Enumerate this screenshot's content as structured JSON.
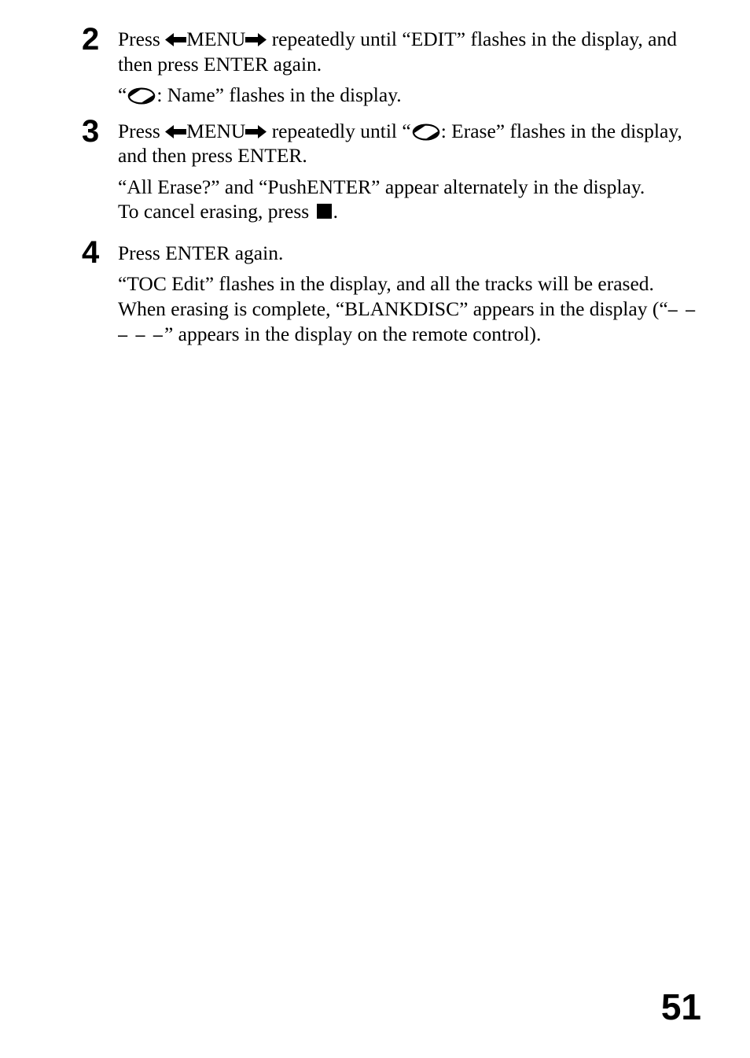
{
  "document": {
    "page_number": "51",
    "type": "instruction-manual-page"
  },
  "steps": [
    {
      "number": "2",
      "lines": [
        {
          "id": "s2l1",
          "segments": [
            {
              "type": "text",
              "text": "Press "
            },
            {
              "type": "icon",
              "icon": "arrow-left"
            },
            {
              "type": "text",
              "text": "MENU"
            },
            {
              "type": "icon",
              "icon": "arrow-right"
            },
            {
              "type": "text",
              "text": " repeatedly until “EDIT” flashes in the display, and then press ENTER again."
            }
          ]
        }
      ],
      "notes": [
        {
          "id": "s2n1",
          "segments": [
            {
              "type": "text",
              "text": "“"
            },
            {
              "type": "icon",
              "icon": "md-disc"
            },
            {
              "type": "text",
              "text": ": Name” flashes in the display."
            }
          ]
        }
      ]
    },
    {
      "number": "3",
      "lines": [
        {
          "id": "s3l1",
          "segments": [
            {
              "type": "text",
              "text": "Press "
            },
            {
              "type": "icon",
              "icon": "arrow-left"
            },
            {
              "type": "text",
              "text": "MENU"
            },
            {
              "type": "icon",
              "icon": "arrow-right"
            },
            {
              "type": "text",
              "text": " repeatedly until “"
            },
            {
              "type": "icon",
              "icon": "md-disc"
            },
            {
              "type": "text",
              "text": ": Erase” flashes in the display, and then press ENTER."
            }
          ]
        }
      ],
      "notes": [
        {
          "id": "s3n1",
          "segments": [
            {
              "type": "text",
              "text": "“All Erase?” and “PushENTER” appear alternately in the display."
            }
          ]
        },
        {
          "id": "s3n2",
          "segments": [
            {
              "type": "text",
              "text": "To cancel erasing, press "
            },
            {
              "type": "icon",
              "icon": "stop-square"
            },
            {
              "type": "text",
              "text": "."
            }
          ]
        }
      ]
    },
    {
      "number": "4",
      "lines": [
        {
          "id": "s4l1",
          "segments": [
            {
              "type": "text",
              "text": "Press ENTER again."
            }
          ]
        }
      ],
      "notes": [
        {
          "id": "s4n1",
          "segments": [
            {
              "type": "text",
              "text": "“TOC Edit” flashes in the display, and all the tracks will be erased."
            }
          ]
        },
        {
          "id": "s4n2",
          "segments": [
            {
              "type": "text",
              "text": "When erasing is complete, “BLANKDISC” appears in the display (“"
            },
            {
              "type": "dashes",
              "text": "– – – – –"
            },
            {
              "type": "text",
              "text": "” appears in the display on the remote control)."
            }
          ]
        }
      ]
    }
  ],
  "icons": {
    "md-disc": "minidisc-symbol",
    "arrow-left": "left-arrow-icon",
    "arrow-right": "right-arrow-icon",
    "stop-square": "stop-button-icon"
  },
  "colors": {
    "ink": "#000000",
    "paper": "#ffffff"
  }
}
